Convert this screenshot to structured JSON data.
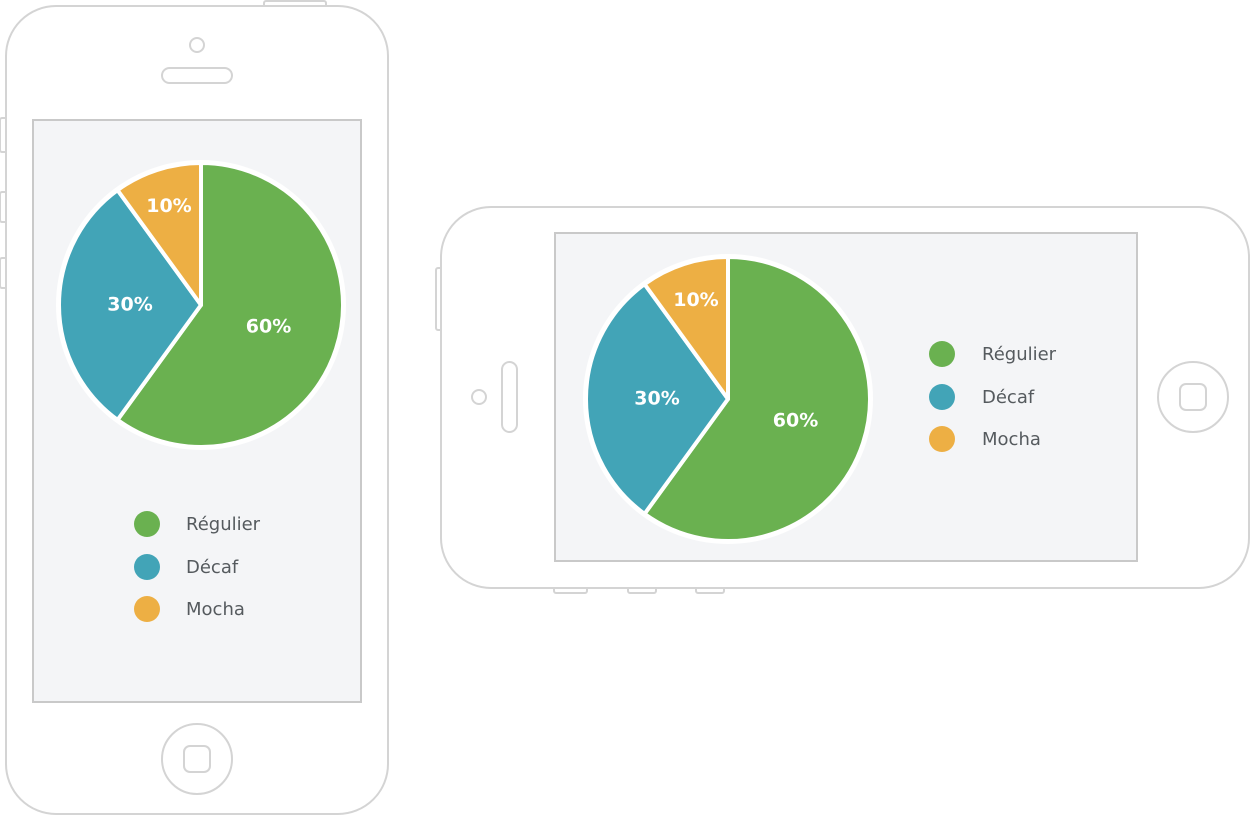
{
  "colors": {
    "frame": "#d4d4d4",
    "screen_bg": "#f4f5f7",
    "screen_border": "#c9c9c9",
    "slice_separator": "#ffffff",
    "legend_text": "#555a5e"
  },
  "chart_data": [
    {
      "type": "pie",
      "device": "portrait-phone",
      "categories": [
        "Régulier",
        "Décaf",
        "Mocha"
      ],
      "values": [
        60,
        30,
        10
      ],
      "labels": [
        "60%",
        "30%",
        "10%"
      ],
      "colors": [
        "#6ab150",
        "#42a4b7",
        "#edaf44"
      ],
      "legend_position": "bottom"
    },
    {
      "type": "pie",
      "device": "landscape-phone",
      "categories": [
        "Régulier",
        "Décaf",
        "Mocha"
      ],
      "values": [
        60,
        30,
        10
      ],
      "labels": [
        "60%",
        "30%",
        "10%"
      ],
      "colors": [
        "#6ab150",
        "#42a4b7",
        "#edaf44"
      ],
      "legend_position": "right"
    }
  ]
}
